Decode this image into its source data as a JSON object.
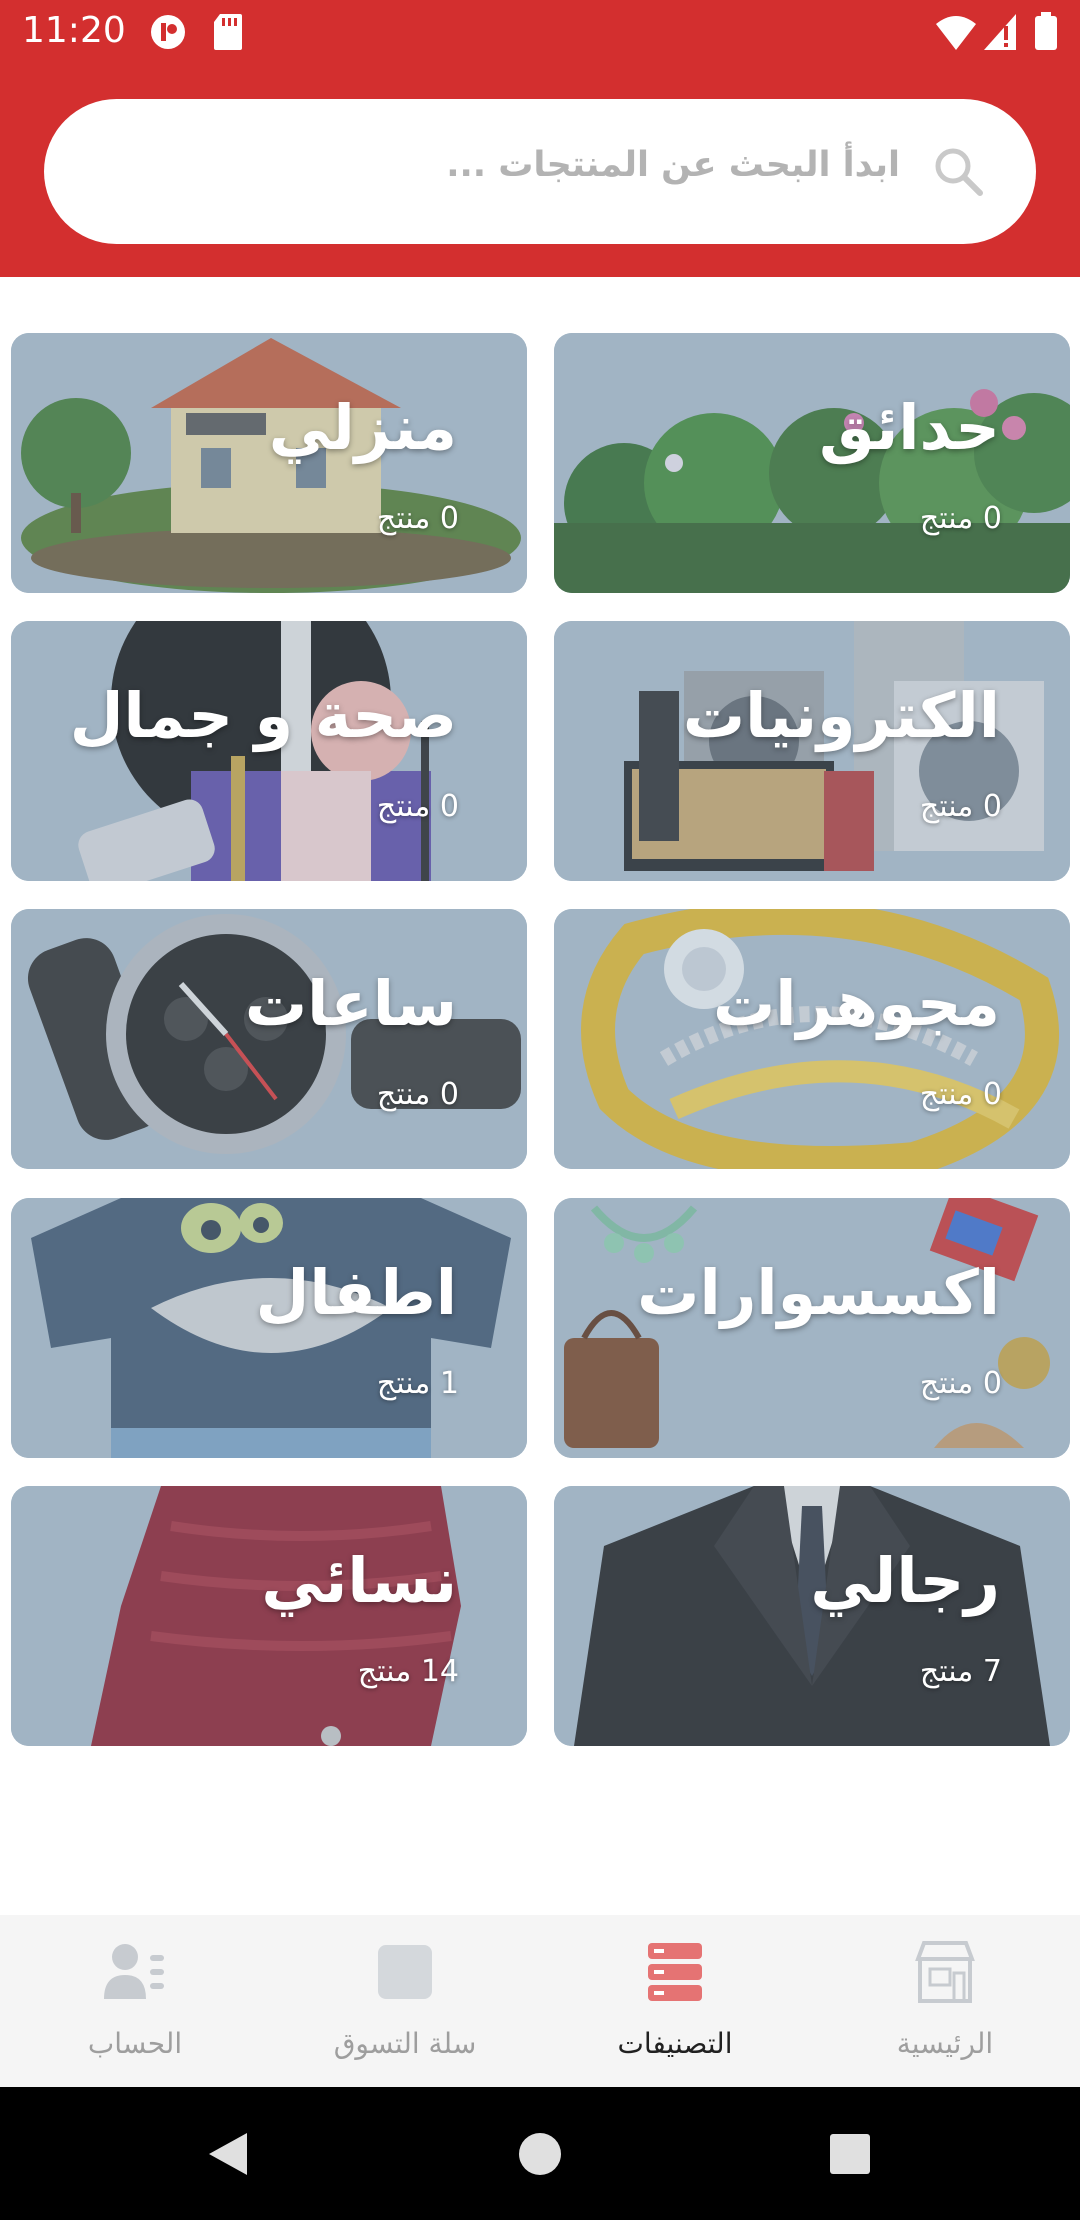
{
  "status_bar": {
    "time": "11:20",
    "icons": [
      "app-notification-icon",
      "sd-card-icon",
      "wifi-icon",
      "signal-icon",
      "battery-icon"
    ]
  },
  "search": {
    "placeholder": "ابدأ البحث عن المنتجات ...",
    "icon": "search-icon"
  },
  "categories": [
    {
      "name": "حدائق",
      "count": "0 منتج",
      "icon": "garden-image"
    },
    {
      "name": "منزلي",
      "count": "0 منتج",
      "icon": "house-image"
    },
    {
      "name": "الكترونيات",
      "count": "0 منتج",
      "icon": "appliances-image"
    },
    {
      "name": "صحة و جمال",
      "count": "0 منتج",
      "icon": "cosmetics-image"
    },
    {
      "name": "مجوهرات",
      "count": "0 منتج",
      "icon": "ring-image"
    },
    {
      "name": "ساعات",
      "count": "0 منتج",
      "icon": "watch-image"
    },
    {
      "name": "اكسسوارات",
      "count": "0 منتج",
      "icon": "accessories-image"
    },
    {
      "name": "اطفال",
      "count": "1 منتج",
      "icon": "kids-shirt-image"
    },
    {
      "name": "رجالي",
      "count": "7 منتج",
      "icon": "suit-image"
    },
    {
      "name": "نسائي",
      "count": "14 منتج",
      "icon": "dress-image"
    }
  ],
  "bottom_nav": {
    "items": [
      {
        "label": "الرئيسية",
        "icon": "store-icon",
        "active": false
      },
      {
        "label": "التصنيفات",
        "icon": "categories-icon",
        "active": true
      },
      {
        "label": "سلة التسوق",
        "icon": "cart-icon",
        "active": false
      },
      {
        "label": "الحساب",
        "icon": "account-icon",
        "active": false
      }
    ]
  },
  "colors": {
    "brand": "#d32f2f",
    "active_icon": "#e57373",
    "inactive_icon": "#c7cbd0"
  }
}
